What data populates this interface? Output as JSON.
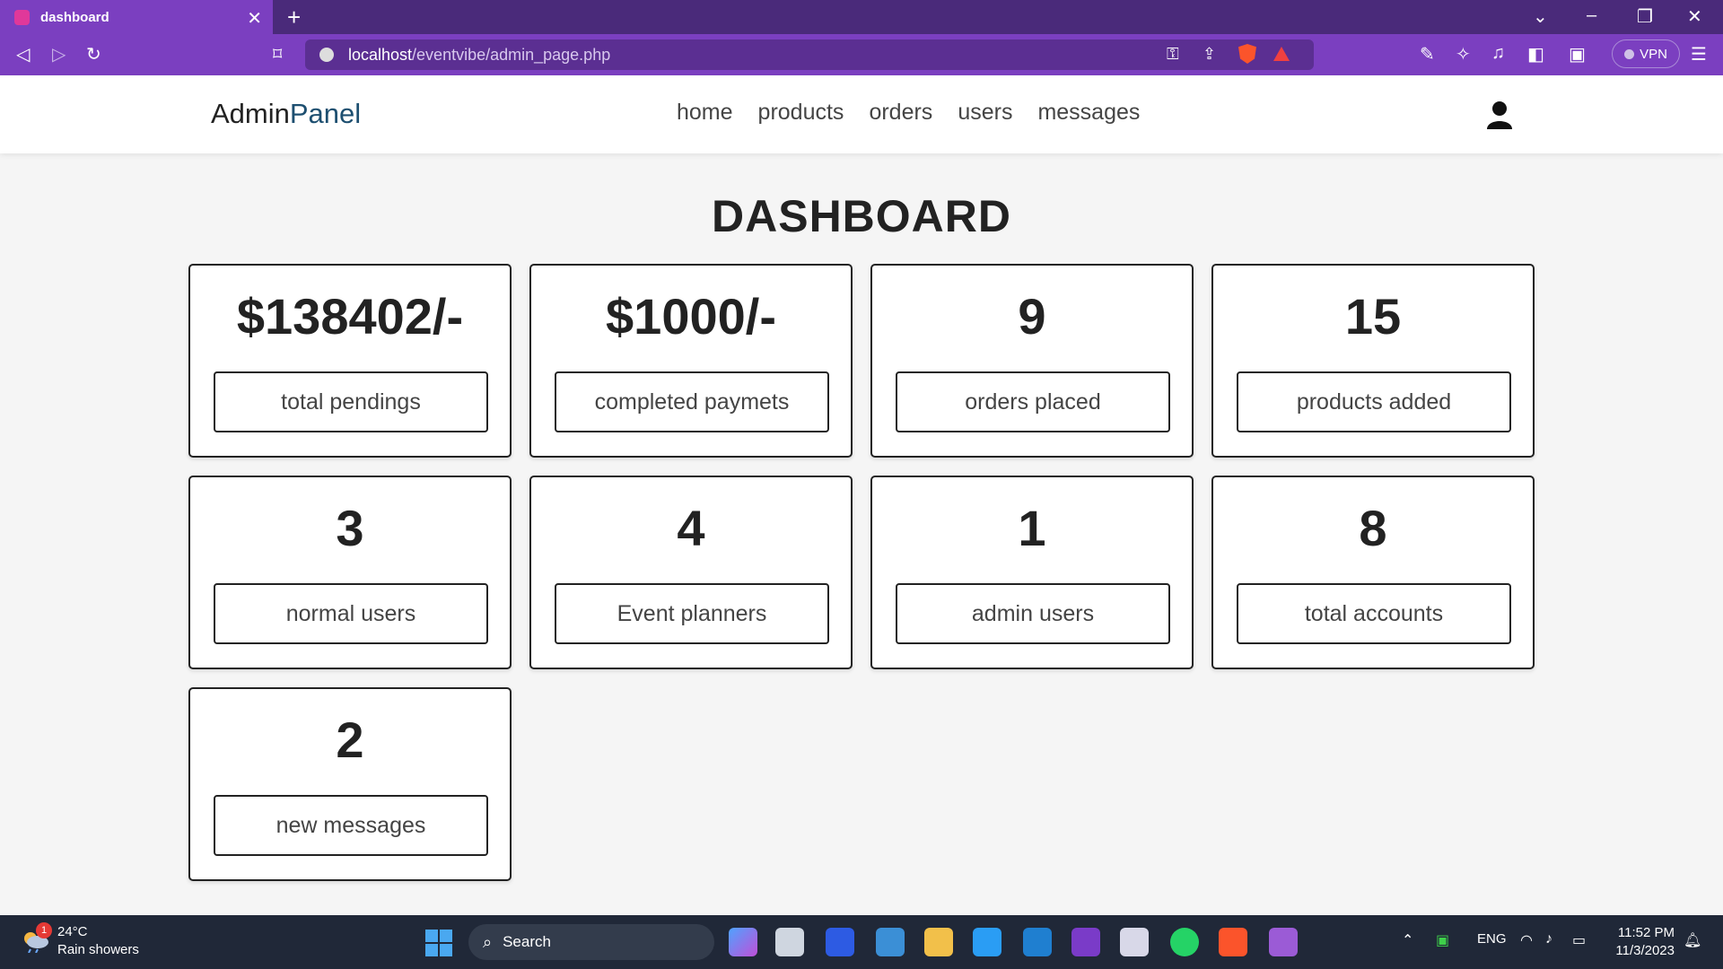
{
  "browser": {
    "tab_title": "dashboard",
    "url_host": "localhost",
    "url_path": "/eventvibe/admin_page.php",
    "vpn_label": "VPN"
  },
  "header": {
    "logo_part1": "Admin",
    "logo_part2": "Panel",
    "nav": [
      "home",
      "products",
      "orders",
      "users",
      "messages"
    ]
  },
  "dashboard": {
    "title": "DASHBOARD",
    "cards": [
      {
        "value": "$138402/-",
        "label": "total pendings"
      },
      {
        "value": "$1000/-",
        "label": "completed paymets"
      },
      {
        "value": "9",
        "label": "orders placed"
      },
      {
        "value": "15",
        "label": "products added"
      },
      {
        "value": "3",
        "label": "normal users"
      },
      {
        "value": "4",
        "label": "Event planners"
      },
      {
        "value": "1",
        "label": "admin users"
      },
      {
        "value": "8",
        "label": "total accounts"
      },
      {
        "value": "2",
        "label": "new messages"
      }
    ]
  },
  "taskbar": {
    "weather_badge": "1",
    "weather_temp": "24°C",
    "weather_desc": "Rain showers",
    "search_label": "Search",
    "language": "ENG",
    "time": "11:52 PM",
    "date": "11/3/2023"
  },
  "colors": {
    "browser_accent": "#7b3fc0",
    "logo_accent": "#1d4f70",
    "page_background": "#f5f5f5"
  }
}
